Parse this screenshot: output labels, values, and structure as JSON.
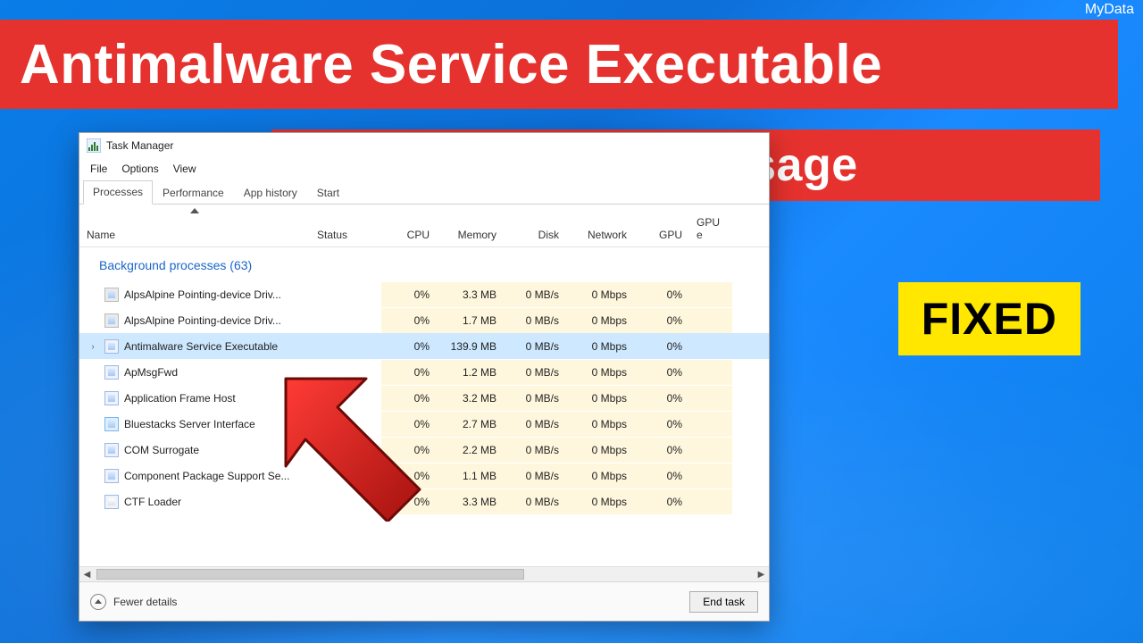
{
  "brand": "MyData",
  "banner_big": "Antimalware Service Executable",
  "banner_small": "High Memory/CPU Usage",
  "fixed_label": "FIXED",
  "taskmgr": {
    "title": "Task Manager",
    "menu": {
      "file": "File",
      "options": "Options",
      "view": "View"
    },
    "tabs": {
      "processes": "Processes",
      "performance": "Performance",
      "apphistory": "App history",
      "startup": "Start"
    },
    "columns": {
      "name": "Name",
      "status": "Status",
      "cpu": "CPU",
      "memory": "Memory",
      "disk": "Disk",
      "network": "Network",
      "gpu": "GPU",
      "gpue": "GPU e"
    },
    "group_title": "Background processes (63)",
    "rows": [
      {
        "name": "AlpsAlpine Pointing-device Driv...",
        "cpu": "0%",
        "mem": "3.3 MB",
        "disk": "0 MB/s",
        "net": "0 Mbps",
        "gpu": "0%",
        "icon": "mon"
      },
      {
        "name": "AlpsAlpine Pointing-device Driv...",
        "cpu": "0%",
        "mem": "1.7 MB",
        "disk": "0 MB/s",
        "net": "0 Mbps",
        "gpu": "0%",
        "icon": "mon"
      },
      {
        "name": "Antimalware Service Executable",
        "cpu": "0%",
        "mem": "139.9 MB",
        "disk": "0 MB/s",
        "net": "0 Mbps",
        "gpu": "0%",
        "selected": true,
        "expandable": true
      },
      {
        "name": "ApMsgFwd",
        "cpu": "0%",
        "mem": "1.2 MB",
        "disk": "0 MB/s",
        "net": "0 Mbps",
        "gpu": "0%"
      },
      {
        "name": "Application Frame Host",
        "cpu": "0%",
        "mem": "3.2 MB",
        "disk": "0 MB/s",
        "net": "0 Mbps",
        "gpu": "0%"
      },
      {
        "name": "Bluestacks Server Interface",
        "cpu": "0%",
        "mem": "2.7 MB",
        "disk": "0 MB/s",
        "net": "0 Mbps",
        "gpu": "0%",
        "icon": "bs"
      },
      {
        "name": "COM Surrogate",
        "cpu": "0%",
        "mem": "2.2 MB",
        "disk": "0 MB/s",
        "net": "0 Mbps",
        "gpu": "0%"
      },
      {
        "name": "Component Package Support Se...",
        "cpu": "0%",
        "mem": "1.1 MB",
        "disk": "0 MB/s",
        "net": "0 Mbps",
        "gpu": "0%"
      },
      {
        "name": "CTF Loader",
        "cpu": "0%",
        "mem": "3.3 MB",
        "disk": "0 MB/s",
        "net": "0 Mbps",
        "gpu": "0%",
        "icon": "ctf"
      }
    ],
    "footer": {
      "fewer": "Fewer details",
      "end_task": "End task"
    }
  }
}
